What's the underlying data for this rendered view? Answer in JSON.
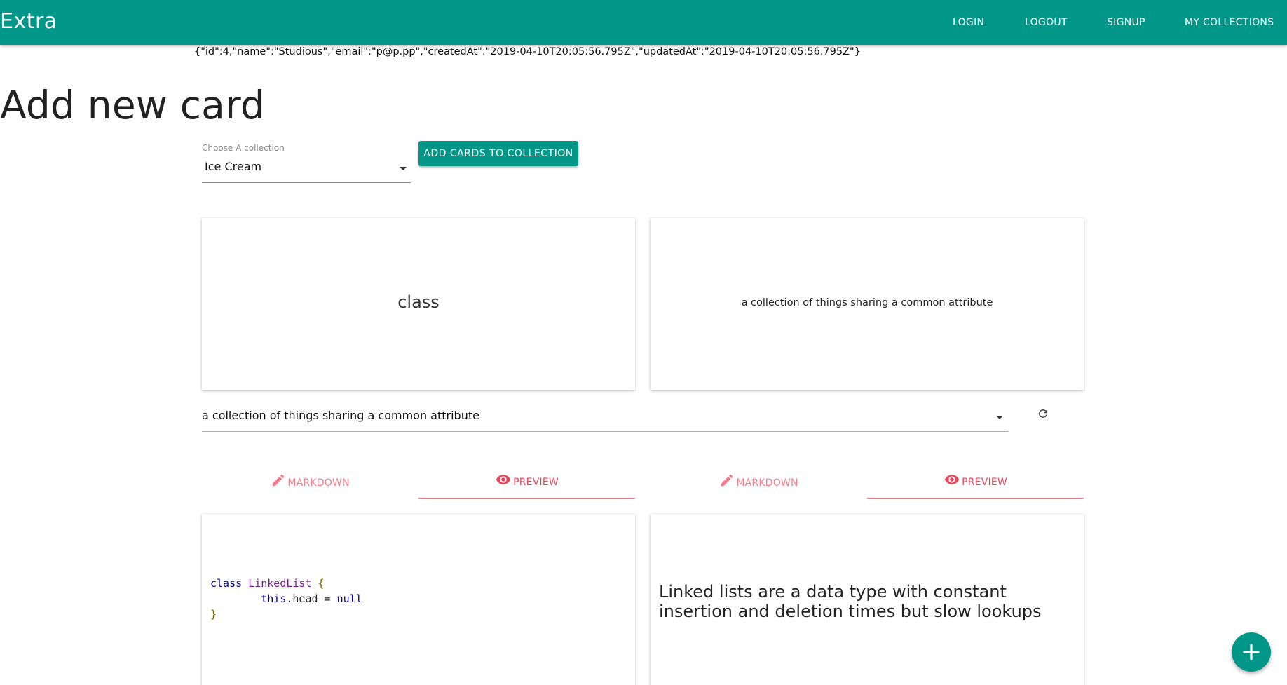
{
  "app": {
    "title": "Extra"
  },
  "nav": {
    "login": "LOGIN",
    "logout": "LOGOUT",
    "signup": "SIGNUP",
    "my_collections": "MY COLLECTIONS"
  },
  "user_json": "{\"id\":4,\"name\":\"Studious\",\"email\":\"p@p.pp\",\"createdAt\":\"2019-04-10T20:05:56.795Z\",\"updatedAt\":\"2019-04-10T20:05:56.795Z\"}",
  "page_title": "Add new card",
  "collection_select": {
    "label": "Choose A collection",
    "value": "Ice Cream"
  },
  "add_button": "ADD CARDS TO COLLECTION",
  "card_front": {
    "text": "class"
  },
  "card_back": {
    "text": "a collection of things sharing a common attribute"
  },
  "definition_select": {
    "value": "a collection of things sharing a common attribute"
  },
  "tabs_left": {
    "markdown": "MARKDOWN",
    "preview": "PREVIEW"
  },
  "tabs_right": {
    "markdown": "MARKDOWN",
    "preview": "PREVIEW"
  },
  "editor_left": {
    "code_line1_kw": "class",
    "code_line1_name": "LinkedList",
    "code_line1_brace": "{",
    "code_line2_this": "this",
    "code_line2_prop": ".head = ",
    "code_line2_null": "null",
    "code_line3_brace": "}"
  },
  "editor_right": {
    "text": "Linked lists are a data type with constant insertion and deletion times but slow lookups"
  },
  "colors": {
    "primary": "#009688",
    "accent": "#f27c8c",
    "focus_underline": "#f0a040"
  },
  "icons": {
    "edit": "pencil-icon",
    "preview": "eye-icon",
    "refresh": "refresh-icon",
    "add": "plus-icon",
    "dropdown": "caret-down-icon"
  }
}
